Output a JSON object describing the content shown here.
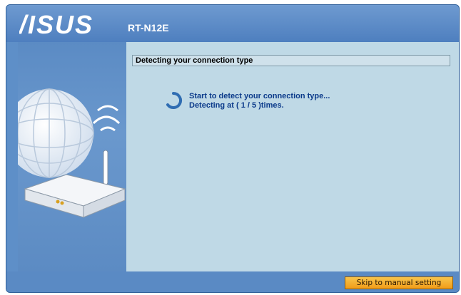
{
  "header": {
    "brand": "ASUS",
    "model": "RT-N12E"
  },
  "content": {
    "section_title": "Detecting your connection type",
    "status_line_1": "Start to detect your connection type...",
    "status_line_2": "Detecting at ( 1 / 5 )times."
  },
  "footer": {
    "skip_label": "Skip to manual setting"
  },
  "colors": {
    "frame_blue": "#5e8fc8",
    "content_bg": "#bfd9e6",
    "status_text": "#0b3a8a",
    "button_orange": "#f29c18"
  }
}
